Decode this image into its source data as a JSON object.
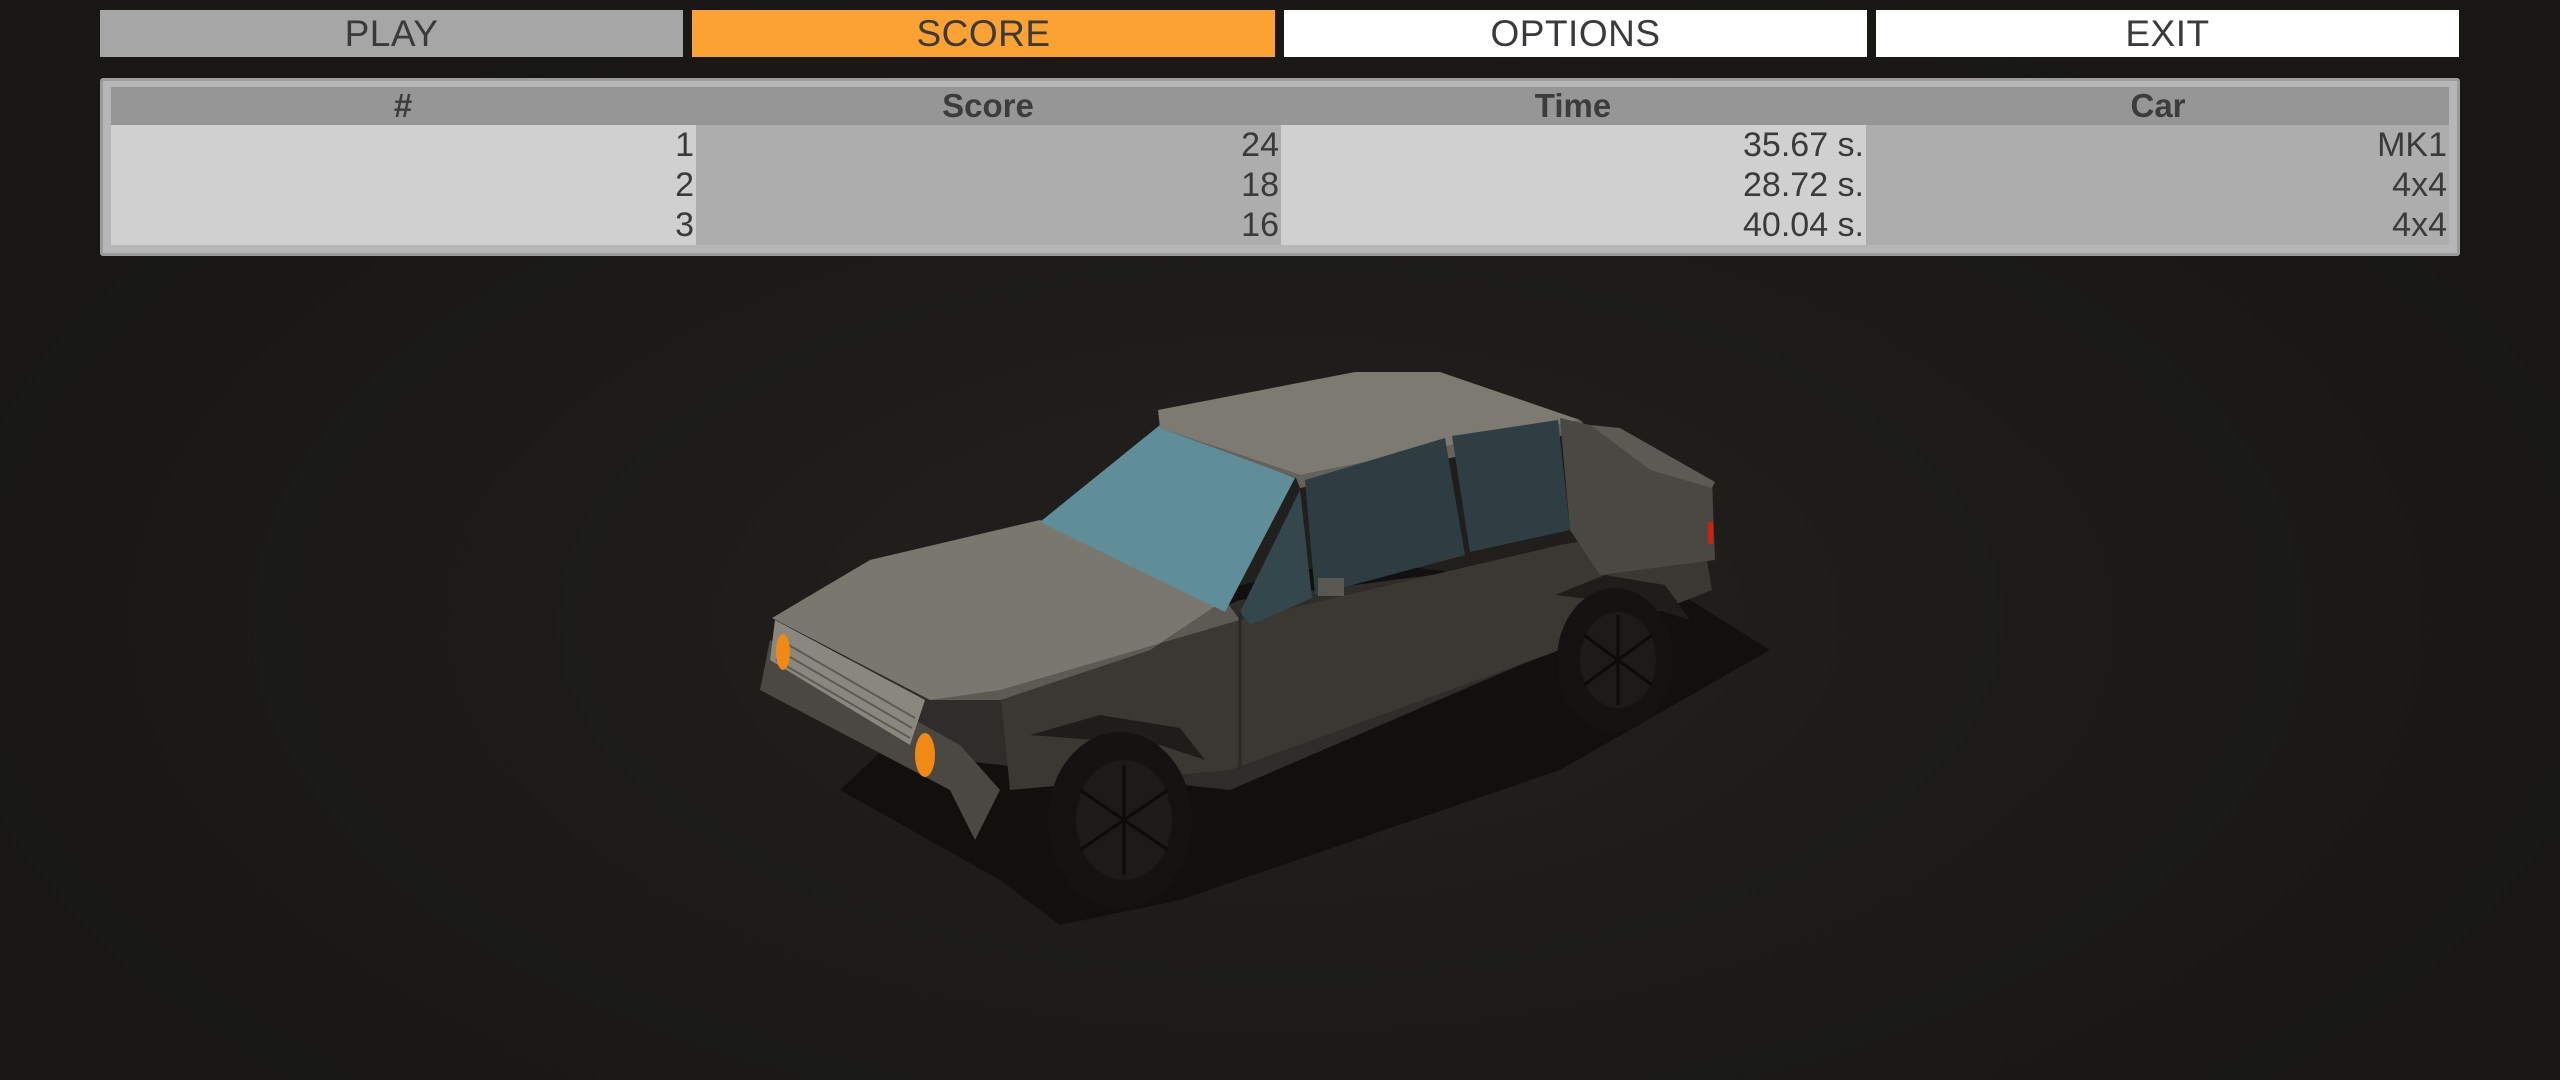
{
  "menu": {
    "play": "PLAY",
    "score": "SCORE",
    "options": "OPTIONS",
    "exit": "EXIT"
  },
  "scoreboard": {
    "headers": [
      "#",
      "Score",
      "Time",
      "Car"
    ],
    "rows": [
      {
        "rank": "1",
        "score": "24",
        "time": "35.67 s.",
        "car": "MK1"
      },
      {
        "rank": "2",
        "score": "18",
        "time": "28.72 s.",
        "car": "4x4"
      },
      {
        "rank": "3",
        "score": "16",
        "time": "40.04 s.",
        "car": "4x4"
      }
    ]
  },
  "colors": {
    "active_tab": "#fba232",
    "inactive_tab": "#a6a6a6",
    "idle_tab": "#ffffff",
    "background": "#1b1a17"
  }
}
